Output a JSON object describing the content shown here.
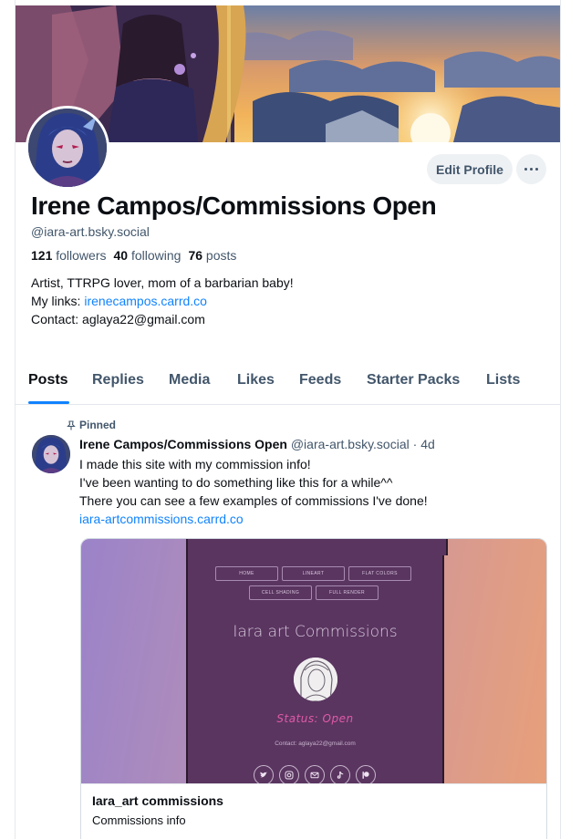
{
  "profile": {
    "display_name": "Irene Campos/Commissions Open",
    "handle": "@iara-art.bsky.social",
    "followers_count": "121",
    "followers_label": "followers",
    "following_count": "40",
    "following_label": "following",
    "posts_count": "76",
    "posts_label": "posts",
    "bio_line1": "Artist,  TTRPG lover, mom of a barbarian baby!",
    "bio_links_prefix": "My links: ",
    "bio_link": "irenecampos.carrd.co",
    "bio_contact": "Contact: aglaya22@gmail.com",
    "edit_button": "Edit Profile",
    "more_icon": "ellipsis-icon"
  },
  "tabs": [
    {
      "label": "Posts",
      "active": true
    },
    {
      "label": "Replies",
      "active": false
    },
    {
      "label": "Media",
      "active": false
    },
    {
      "label": "Likes",
      "active": false
    },
    {
      "label": "Feeds",
      "active": false
    },
    {
      "label": "Starter Packs",
      "active": false
    },
    {
      "label": "Lists",
      "active": false
    }
  ],
  "post": {
    "pinned_label": "Pinned",
    "pin_icon": "pin-icon",
    "author_name": "Irene Campos/Commissions Open",
    "author_handle": "@iara-art.bsky.social",
    "separator": "·",
    "time_ago": "4d",
    "line1": "I made this site with my commission info!",
    "line2": "I've been wanting to do something like this for a while^^",
    "line3": "There you can see a few examples of commissions I've done!",
    "link": "iara-artcommissions.carrd.co",
    "embed": {
      "nav_row1": [
        "HOME",
        "LINEART",
        "FLAT COLORS"
      ],
      "nav_row2": [
        "CELL SHADING",
        "FULL RENDER"
      ],
      "site_title": "Iara art Commissions",
      "status": "Status: Open",
      "contact": "Contact: aglaya22@gmail.com",
      "socials": [
        "twitter-icon",
        "instagram-icon",
        "mail-icon",
        "tiktok-icon",
        "patreon-icon"
      ],
      "card_title": "Iara_art commissions",
      "card_description": "Commissions info"
    }
  },
  "colors": {
    "accent": "#1083fe",
    "text": "#0b0f14",
    "muted": "#42566b",
    "site_bg": "#5a3560",
    "status": "#e05aa8"
  }
}
